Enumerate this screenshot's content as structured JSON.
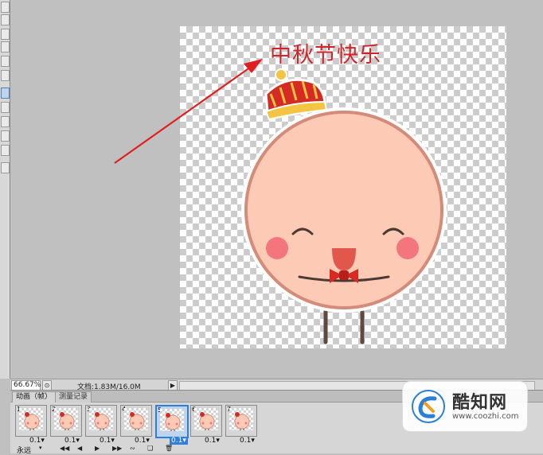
{
  "canvas": {
    "text_overlay": "中秋节快乐",
    "title_color": "#d0242a",
    "annotation_arrow_color": "#e02020",
    "face_colors": {
      "skin": "#fdcbb5",
      "outline": "#d48b79",
      "cheek": "#f2767c",
      "tongue": "#e2574c",
      "bow": "#d62a24",
      "hat": "#d62a24",
      "hat_band": "#f3c542"
    }
  },
  "status": {
    "zoom": "66.67%",
    "zoom_icon": "options-icon",
    "doc_info": "文档:1.83M/16.0M",
    "menu_arrow": "▶"
  },
  "panel": {
    "tabs": [
      {
        "label": "动画（帧）",
        "active": true
      },
      {
        "label": "测量记录",
        "active": false
      }
    ],
    "frames": [
      {
        "number": "1",
        "delay": "0.1▾",
        "selected": false
      },
      {
        "number": "2",
        "delay": "0.1▾",
        "selected": false
      },
      {
        "number": "3",
        "delay": "0.1▾",
        "selected": false
      },
      {
        "number": "4",
        "delay": "0.1▾",
        "selected": false
      },
      {
        "number": "5",
        "delay": "0.1▾",
        "selected": true
      },
      {
        "number": "6",
        "delay": "0.1▾",
        "selected": false
      },
      {
        "number": "7",
        "delay": "0.1▾",
        "selected": false
      }
    ],
    "loop": {
      "label": "永远",
      "arrow": "▾"
    },
    "controls": [
      {
        "icon": "first-frame-icon",
        "glyph": "◀◀"
      },
      {
        "icon": "prev-frame-icon",
        "glyph": "◀"
      },
      {
        "icon": "play-icon",
        "glyph": "▶"
      },
      {
        "icon": "next-frame-icon",
        "glyph": "▶▶"
      },
      {
        "icon": "tween-icon",
        "glyph": "∾"
      },
      {
        "icon": "new-frame-icon",
        "glyph": "❑"
      },
      {
        "icon": "delete-frame-icon",
        "glyph": "🗑"
      }
    ]
  },
  "watermark": {
    "name": "酷知网",
    "url": "www.coozhi.com",
    "logo_color": "#2a7fd6"
  }
}
